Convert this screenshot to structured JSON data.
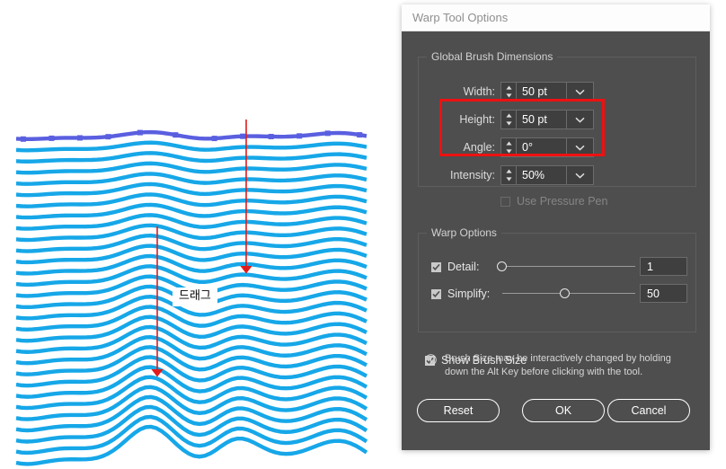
{
  "canvas": {
    "annotation_label": "드래그",
    "arrow_color": "#e01b1b",
    "wave_color": "#16a7e8",
    "selected_path_color": "#5a5fe0"
  },
  "dialog": {
    "title": "Warp Tool Options",
    "groups": {
      "global_brush": {
        "legend": "Global Brush Dimensions",
        "fields": [
          {
            "label": "Width:",
            "value": "50 pt",
            "highlighted": true
          },
          {
            "label": "Height:",
            "value": "50 pt",
            "highlighted": true
          },
          {
            "label": "Angle:",
            "value": "0°",
            "highlighted": false
          },
          {
            "label": "Intensity:",
            "value": "50%",
            "highlighted": false
          }
        ],
        "pressure_pen": {
          "label": "Use Pressure Pen",
          "checked": false,
          "enabled": false
        }
      },
      "warp_options": {
        "legend": "Warp Options",
        "sliders": [
          {
            "label": "Detail:",
            "checked": true,
            "value": "1",
            "knob_percent": 2
          },
          {
            "label": "Simplify:",
            "checked": true,
            "value": "50",
            "knob_percent": 50
          }
        ]
      }
    },
    "show_brush_size": {
      "label": "Show Brush Size",
      "checked": true
    },
    "info_note": "Brush Size may be interactively changed by holding down the Alt Key before clicking with the tool.",
    "buttons": {
      "reset": "Reset",
      "ok": "OK",
      "cancel": "Cancel"
    },
    "icons": {
      "stepper": "up-down-stepper-icon",
      "dropdown": "chevron-down-icon",
      "info": "info-icon"
    },
    "highlight_color": "#ee1111"
  }
}
